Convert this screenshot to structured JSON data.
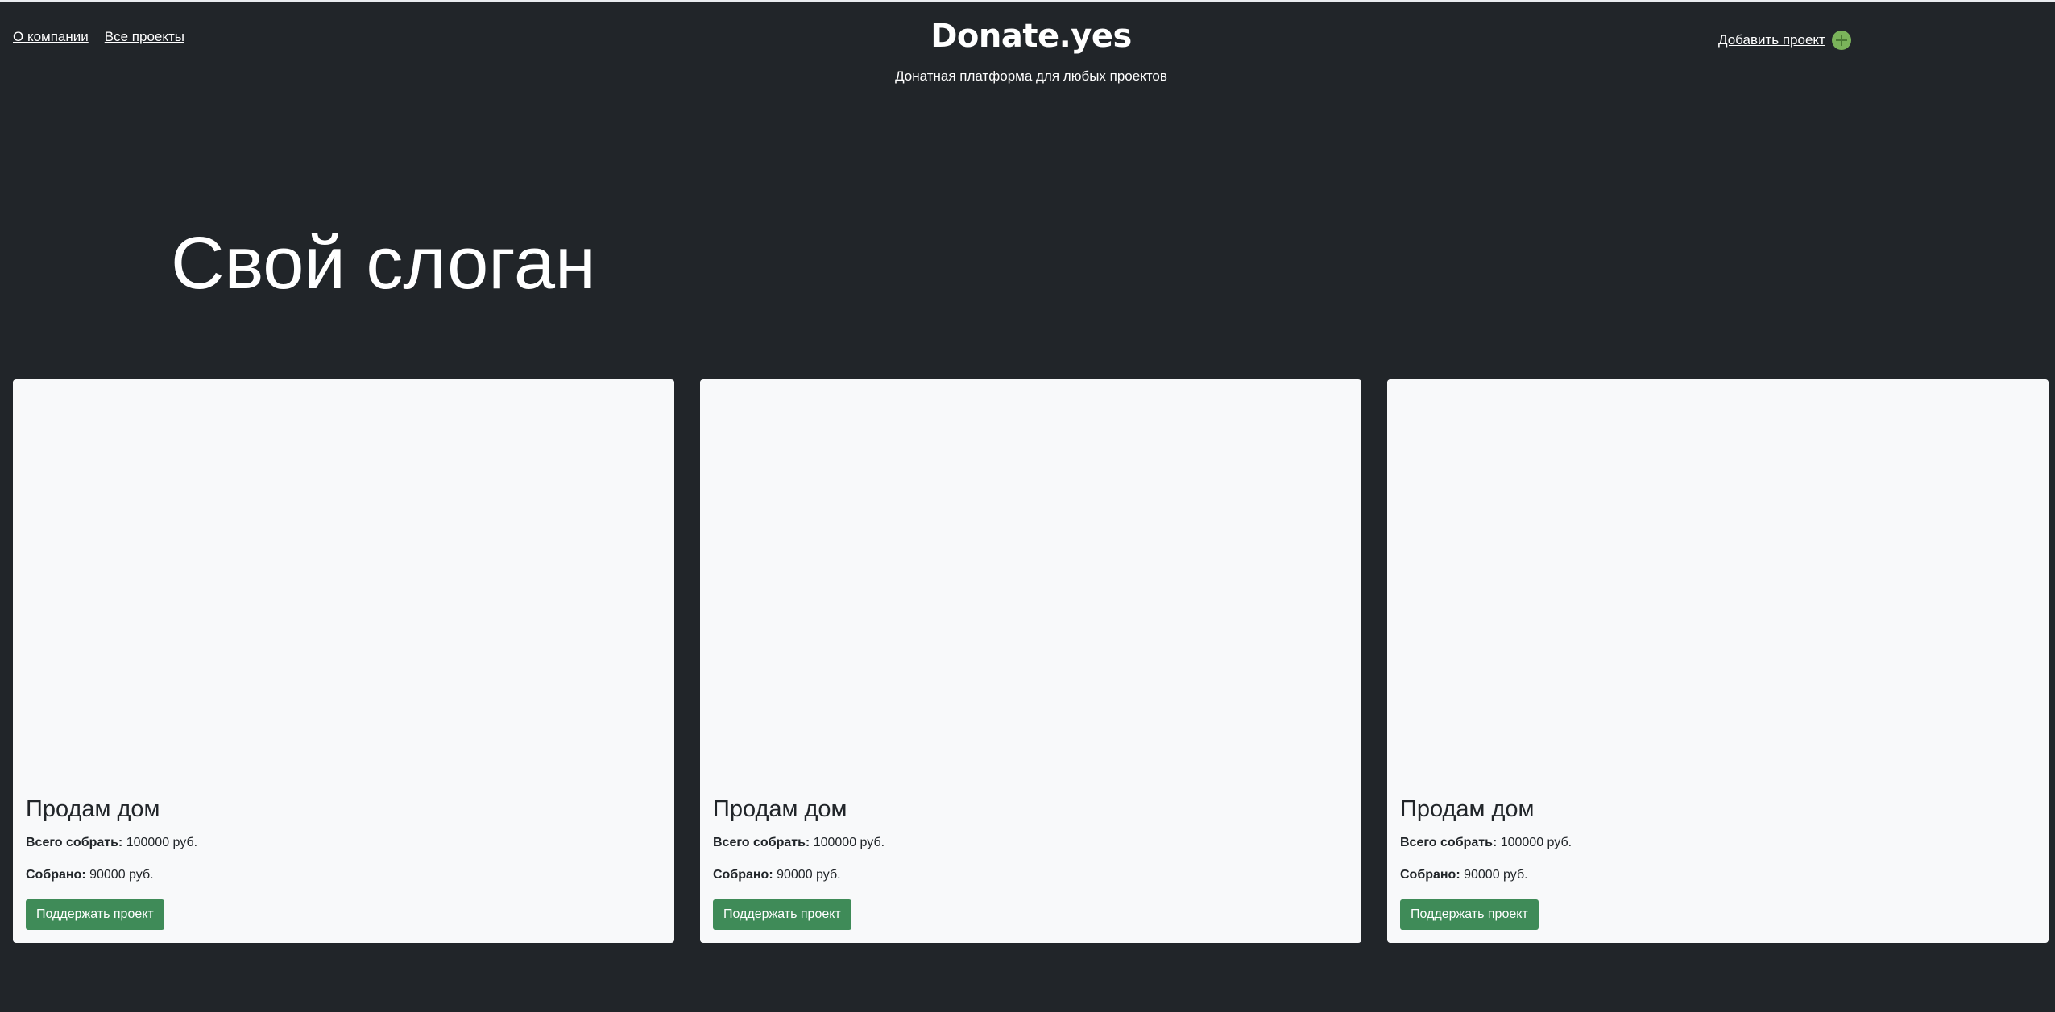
{
  "nav": {
    "about_label": "О компании",
    "projects_label": "Все проекты",
    "add_project_label": "Добавить проект",
    "add_icon": "plus-circle-icon"
  },
  "brand": {
    "title": "Donate.yes",
    "subtitle": "Донатная платформа для любых проектов"
  },
  "hero": {
    "slogan": "Свой слоган"
  },
  "colors": {
    "background": "#212529",
    "card": "#f8f9fa",
    "button": "#3f8b58",
    "plus_icon": "#7ab35a"
  },
  "projects": [
    {
      "title": "Продам дом",
      "goal_label": "Всего собрать:",
      "goal_value": "100000 руб.",
      "raised_label": "Собрано:",
      "raised_value": "90000 руб.",
      "button_label": "Поддержать проект"
    },
    {
      "title": "Продам дом",
      "goal_label": "Всего собрать:",
      "goal_value": "100000 руб.",
      "raised_label": "Собрано:",
      "raised_value": "90000 руб.",
      "button_label": "Поддержать проект"
    },
    {
      "title": "Продам дом",
      "goal_label": "Всего собрать:",
      "goal_value": "100000 руб.",
      "raised_label": "Собрано:",
      "raised_value": "90000 руб.",
      "button_label": "Поддержать проект"
    }
  ]
}
